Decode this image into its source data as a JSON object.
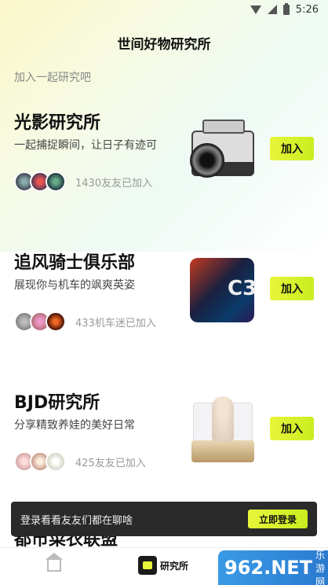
{
  "status_bar": {
    "time": "5:26"
  },
  "header": {
    "title": "世间好物研究所",
    "subtitle": "加入一起研究吧"
  },
  "clubs": [
    {
      "name": "光影研究所",
      "description": "一起捕捉瞬间，让日子有迹可",
      "joined": "1430友友已加入",
      "join_label": "加入",
      "thumb_icon": "camera-icon"
    },
    {
      "name": "追风骑士俱乐部",
      "description": "展现你与机车的飒爽英姿",
      "joined": "433机车迷已加入",
      "join_label": "加入",
      "thumb_icon": "cube-icon",
      "thumb_text": "C3"
    },
    {
      "name": "BJD研究所",
      "description": "分享精致养娃的美好日常",
      "joined": "425友友已加入",
      "join_label": "加入",
      "thumb_icon": "doll-box-icon"
    }
  ],
  "peek": {
    "name": "都市菜衣联盟"
  },
  "toast": {
    "text": "登录看看友友们都在聊啥",
    "button": "立即登录"
  },
  "tabbar": {
    "lab_label": "研究所"
  },
  "watermark": {
    "big": "962.NET",
    "sub": "乐游网"
  },
  "colors": {
    "accent": "#e3f33a",
    "toast_bg": "#2a2a2a"
  }
}
